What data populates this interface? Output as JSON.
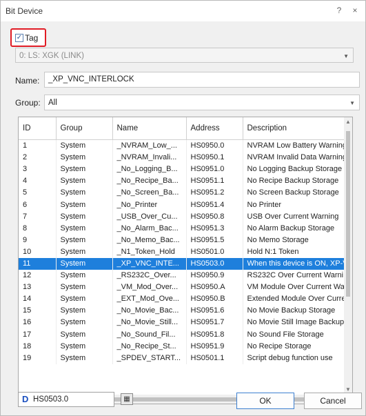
{
  "window": {
    "title": "Bit Device",
    "help": "?",
    "close": "×"
  },
  "tag": {
    "checked": true,
    "label": "Tag",
    "checkmark": "✓"
  },
  "device_combo": {
    "value": "0: LS: XGK (LINK)"
  },
  "name": {
    "label": "Name:",
    "value": "_XP_VNC_INTERLOCK"
  },
  "group": {
    "label": "Group:",
    "value": "All"
  },
  "table": {
    "columns": [
      "ID",
      "Group",
      "Name",
      "Address",
      "Description"
    ],
    "rows": [
      [
        "1",
        "System",
        "_NVRAM_Low_...",
        "HS0950.0",
        "NVRAM Low Battery Warning"
      ],
      [
        "2",
        "System",
        "_NVRAM_Invali...",
        "HS0950.1",
        "NVRAM Invalid Data Warning"
      ],
      [
        "3",
        "System",
        "_No_Logging_B...",
        "HS0951.0",
        "No Logging Backup Storage"
      ],
      [
        "4",
        "System",
        "_No_Recipe_Ba...",
        "HS0951.1",
        "No Recipe Backup Storage"
      ],
      [
        "5",
        "System",
        "_No_Screen_Ba...",
        "HS0951.2",
        "No Screen Backup Storage"
      ],
      [
        "6",
        "System",
        "_No_Printer",
        "HS0951.4",
        "No Printer"
      ],
      [
        "7",
        "System",
        "_USB_Over_Cu...",
        "HS0950.8",
        "USB Over Current Warning"
      ],
      [
        "8",
        "System",
        "_No_Alarm_Bac...",
        "HS0951.3",
        "No Alarm Backup Storage"
      ],
      [
        "9",
        "System",
        "_No_Memo_Bac...",
        "HS0951.5",
        "No Memo Storage"
      ],
      [
        "10",
        "System",
        "_N1_Token_Hold",
        "HS0501.0",
        "Hold N:1 Token"
      ],
      [
        "11",
        "System",
        "_XP_VNC_INTE...",
        "HS0503.0",
        "When this device is ON, XP-V"
      ],
      [
        "12",
        "System",
        "_RS232C_Over...",
        "HS0950.9",
        "RS232C Over Current Warni"
      ],
      [
        "13",
        "System",
        "_VM_Mod_Over...",
        "HS0950.A",
        "VM Module Over Current Wa"
      ],
      [
        "14",
        "System",
        "_EXT_Mod_Ove...",
        "HS0950.B",
        "Extended Module Over Curre"
      ],
      [
        "15",
        "System",
        "_No_Movie_Bac...",
        "HS0951.6",
        "No Movie Backup Storage"
      ],
      [
        "16",
        "System",
        "_No_Movie_Still...",
        "HS0951.7",
        "No Movie Still Image Backup"
      ],
      [
        "17",
        "System",
        "_No_Sound_Fil...",
        "HS0951.8",
        "No Sound File Storage"
      ],
      [
        "18",
        "System",
        "_No_Recipe_St...",
        "HS0951.9",
        "No Recipe Storage"
      ],
      [
        "19",
        "System",
        "_SPDEV_START...",
        "HS0501.1",
        "Script debug function use"
      ]
    ],
    "selected_index": 10
  },
  "address": {
    "icon": "D",
    "value": "HS0503.0"
  },
  "buttons": {
    "ok": "OK",
    "cancel": "Cancel"
  },
  "colors": {
    "selection": "#1e7fdc",
    "highlight_border": "#e01b24"
  }
}
